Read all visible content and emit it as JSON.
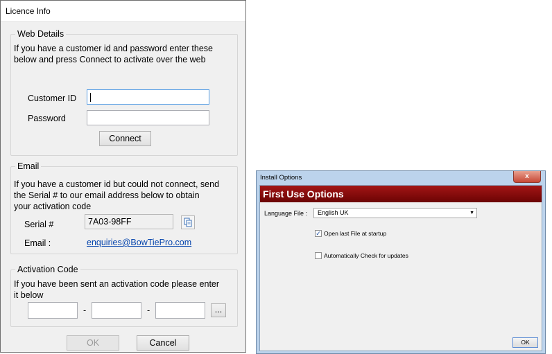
{
  "licence": {
    "title": "Licence Info",
    "web": {
      "legend": "Web Details",
      "desc_line1": "If you have a customer id and password enter these",
      "desc_line2": "below  and press Connect to activate over the web",
      "customer_id_label": "Customer ID",
      "customer_id_value": "",
      "password_label": "Password",
      "password_value": "",
      "connect_label": "Connect"
    },
    "email": {
      "legend": "Email",
      "desc_line1": "If you have a customer id but could not connect, send",
      "desc_line2": "the Serial # to our email address below to obtain",
      "desc_line3": "your activation code",
      "serial_label": "Serial #",
      "serial_value": "7A03-98FF",
      "email_label": "Email :",
      "email_value": "enquiries@BowTiePro.com"
    },
    "activation": {
      "legend": "Activation Code",
      "desc_line1": "If you have been sent an activation code please enter",
      "desc_line2": "it below",
      "sep": "-",
      "browse_label": "..."
    },
    "ok_label": "OK",
    "cancel_label": "Cancel"
  },
  "install": {
    "title": "Install Options",
    "close_label": "x",
    "banner": "First Use Options",
    "language_label": "Language File :",
    "language_value": "English UK",
    "open_last_label": "Open last File at startup",
    "open_last_checked": true,
    "auto_check_label": "Automatically Check for updates",
    "auto_check_checked": false,
    "ok_label": "OK"
  },
  "colors": {
    "banner": "#8b0a0a",
    "link": "#0645ad",
    "focus_border": "#569de5"
  }
}
